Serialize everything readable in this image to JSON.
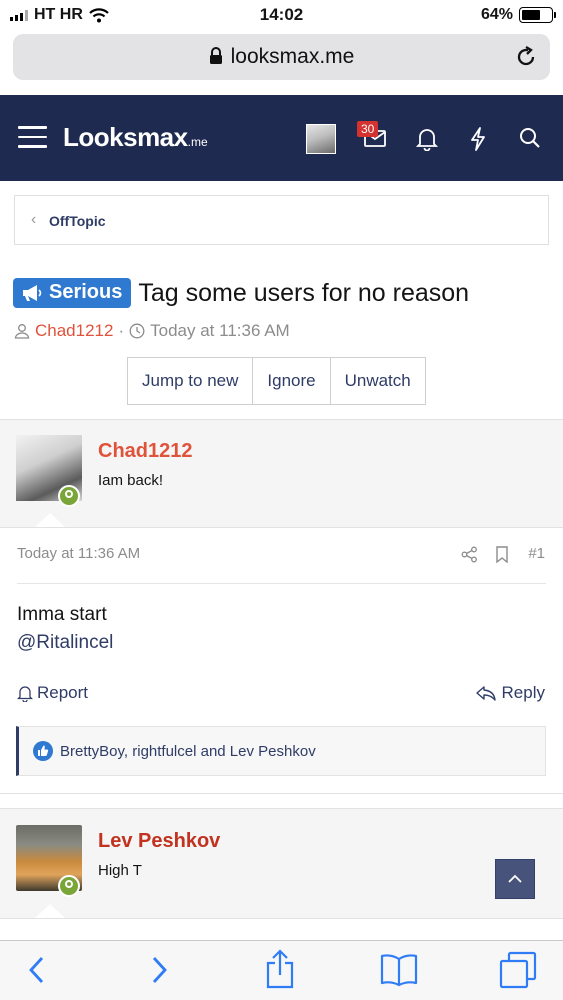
{
  "status_bar": {
    "carrier": "HT HR",
    "time": "14:02",
    "battery": "64%"
  },
  "browser": {
    "url": "looksmax.me"
  },
  "site_header": {
    "logo_main": "Looksmax",
    "logo_suffix": ".me",
    "notification_count": "30"
  },
  "breadcrumb": {
    "label": "OffTopic"
  },
  "thread": {
    "prefix": "Serious",
    "title": "Tag some users for no reason",
    "author": "Chad1212",
    "separator": "·",
    "date": "Today at 11:36 AM"
  },
  "actions": {
    "jump_label": "Jump to new",
    "ignore_label": "Ignore",
    "unwatch_label": "Unwatch"
  },
  "posts": [
    {
      "username": "Chad1212",
      "user_title": "Iam back!",
      "date": "Today at 11:36 AM",
      "number": "#1",
      "body_line1": "Imma start",
      "body_mention": "@Ritalincel",
      "report_label": "Report",
      "reply_label": "Reply",
      "likes": "BrettyBoy, rightfulcel and Lev Peshkov"
    },
    {
      "username": "Lev Peshkov",
      "user_title": "High T"
    }
  ],
  "colors": {
    "header_bg": "#1e2a50",
    "link": "#2f3c66",
    "prefix_bg": "#2f79d0",
    "author": "#e0533b",
    "username2": "#c1321f",
    "online": "#7aa539"
  }
}
